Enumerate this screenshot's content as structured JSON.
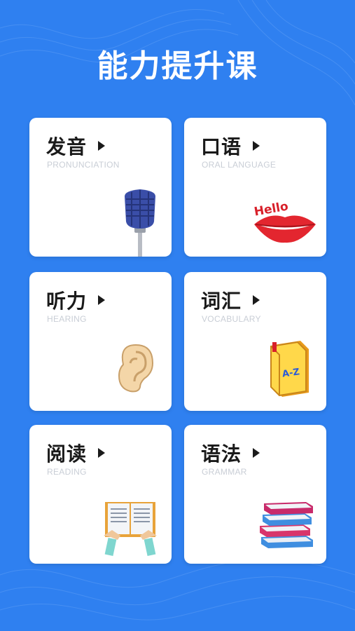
{
  "page": {
    "title": "能力提升课"
  },
  "cards": [
    {
      "title": "发音",
      "subtitle": "PRONUNCIATION",
      "icon": "microphone-icon"
    },
    {
      "title": "口语",
      "subtitle": "ORAL LANGUAGE",
      "icon": "lips-hello-icon",
      "icon_text": "Hello"
    },
    {
      "title": "听力",
      "subtitle": "HEARING",
      "icon": "ear-icon"
    },
    {
      "title": "词汇",
      "subtitle": "VOCABULARY",
      "icon": "dictionary-book-icon",
      "icon_text": "A-Z"
    },
    {
      "title": "阅读",
      "subtitle": "READING",
      "icon": "open-book-icon"
    },
    {
      "title": "语法",
      "subtitle": "GRAMMAR",
      "icon": "book-stack-icon"
    }
  ],
  "colors": {
    "background": "#2f80f0",
    "card": "#ffffff",
    "title": "#1a1a1a",
    "subtitle": "#c9ced6"
  }
}
